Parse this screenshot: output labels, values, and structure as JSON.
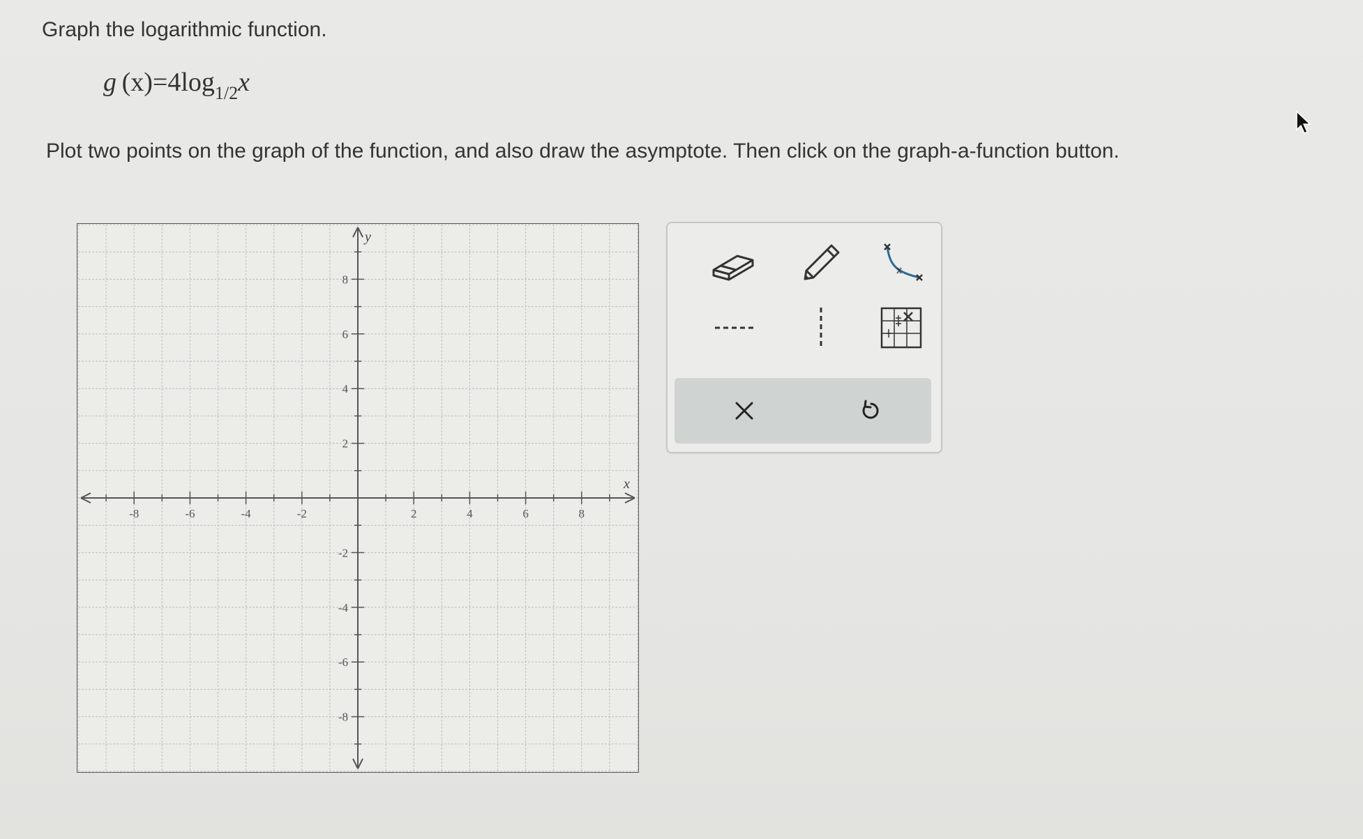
{
  "prompt": "Graph the logarithmic function.",
  "formula": {
    "lhs": "g",
    "arg": "(x)",
    "equals": "=",
    "coefficient": "4",
    "log": "log",
    "base": "1/2",
    "variable": "x"
  },
  "instruction": "Plot two points on the graph of the function, and also draw the asymptote. Then click on the graph-a-function button.",
  "graph": {
    "x_axis_label": "x",
    "y_axis_label": "y",
    "x_range": [
      -10,
      10
    ],
    "y_range": [
      -10,
      10
    ],
    "grid_step": 1,
    "x_tick_labels": [
      "-8",
      "-6",
      "-4",
      "-2",
      "2",
      "4",
      "6",
      "8"
    ],
    "y_tick_labels": [
      "8",
      "6",
      "4",
      "2",
      "-2",
      "-4",
      "-6",
      "-8"
    ]
  },
  "toolbar": {
    "tools": [
      {
        "name": "eraser-tool",
        "icon": "eraser-icon"
      },
      {
        "name": "pencil-tool",
        "icon": "pencil-icon"
      },
      {
        "name": "graph-a-function-tool",
        "icon": "log-curve-icon"
      },
      {
        "name": "horizontal-asymptote-tool",
        "icon": "horizontal-dashed-line-icon"
      },
      {
        "name": "vertical-asymptote-tool",
        "icon": "vertical-dashed-line-icon"
      },
      {
        "name": "point-grid-tool",
        "icon": "grid-point-icon"
      }
    ],
    "actions": [
      {
        "name": "clear-button",
        "icon": "close-icon"
      },
      {
        "name": "undo-button",
        "icon": "undo-icon"
      }
    ]
  },
  "colors": {
    "background": "#e8e8e6",
    "grid": "#bdbdbd",
    "axis": "#555555",
    "icon": "#333333",
    "action_bar": "#cfd3d2"
  }
}
